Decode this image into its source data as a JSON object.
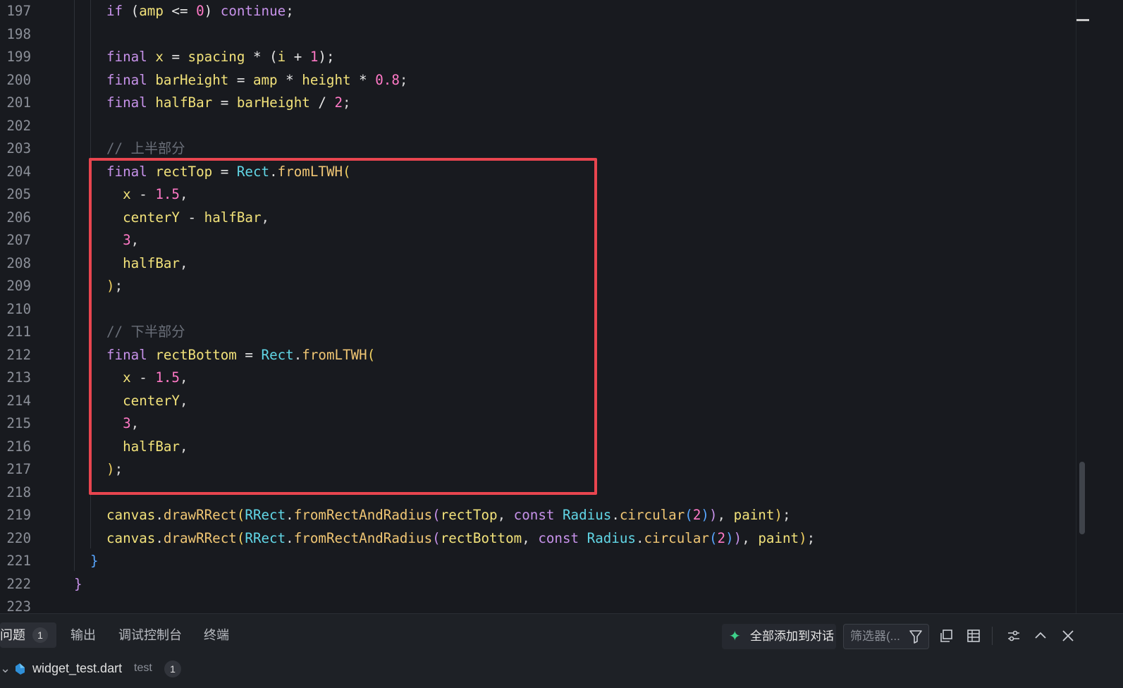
{
  "editor": {
    "lines": [
      {
        "num": "197",
        "tokens": [
          [
            "kw",
            "if"
          ],
          [
            "op",
            " ("
          ],
          [
            "id",
            "amp"
          ],
          [
            "op",
            " <= "
          ],
          [
            "num",
            "0"
          ],
          [
            "op",
            ") "
          ],
          [
            "kw",
            "continue"
          ],
          [
            "pn",
            ";"
          ]
        ]
      },
      {
        "num": "198",
        "tokens": []
      },
      {
        "num": "199",
        "tokens": [
          [
            "kw",
            "final"
          ],
          [
            "op",
            " "
          ],
          [
            "id",
            "x"
          ],
          [
            "op",
            " = "
          ],
          [
            "id",
            "spacing"
          ],
          [
            "op",
            " * ("
          ],
          [
            "id",
            "i"
          ],
          [
            "op",
            " + "
          ],
          [
            "num",
            "1"
          ],
          [
            "op",
            ");"
          ]
        ]
      },
      {
        "num": "200",
        "tokens": [
          [
            "kw",
            "final"
          ],
          [
            "op",
            " "
          ],
          [
            "id",
            "barHeight"
          ],
          [
            "op",
            " = "
          ],
          [
            "id",
            "amp"
          ],
          [
            "op",
            " * "
          ],
          [
            "id",
            "height"
          ],
          [
            "op",
            " * "
          ],
          [
            "num",
            "0.8"
          ],
          [
            "pn",
            ";"
          ]
        ]
      },
      {
        "num": "201",
        "tokens": [
          [
            "kw",
            "final"
          ],
          [
            "op",
            " "
          ],
          [
            "id",
            "halfBar"
          ],
          [
            "op",
            " = "
          ],
          [
            "id",
            "barHeight"
          ],
          [
            "op",
            " / "
          ],
          [
            "num",
            "2"
          ],
          [
            "pn",
            ";"
          ]
        ]
      },
      {
        "num": "202",
        "tokens": []
      },
      {
        "num": "203",
        "tokens": [
          [
            "cm",
            "// 上半部分"
          ]
        ]
      },
      {
        "num": "204",
        "tokens": [
          [
            "kw",
            "final"
          ],
          [
            "op",
            " "
          ],
          [
            "id",
            "rectTop"
          ],
          [
            "op",
            " = "
          ],
          [
            "ty",
            "Rect"
          ],
          [
            "pn",
            "."
          ],
          [
            "fn",
            "fromLTWH"
          ],
          [
            "br1",
            "("
          ]
        ]
      },
      {
        "num": "205",
        "tokens": [
          [
            "op",
            "  "
          ],
          [
            "id",
            "x"
          ],
          [
            "op",
            " - "
          ],
          [
            "num",
            "1.5"
          ],
          [
            "pn",
            ","
          ]
        ]
      },
      {
        "num": "206",
        "tokens": [
          [
            "op",
            "  "
          ],
          [
            "id",
            "centerY"
          ],
          [
            "op",
            " - "
          ],
          [
            "id",
            "halfBar"
          ],
          [
            "pn",
            ","
          ]
        ]
      },
      {
        "num": "207",
        "tokens": [
          [
            "op",
            "  "
          ],
          [
            "num",
            "3"
          ],
          [
            "pn",
            ","
          ]
        ]
      },
      {
        "num": "208",
        "tokens": [
          [
            "op",
            "  "
          ],
          [
            "id",
            "halfBar"
          ],
          [
            "pn",
            ","
          ]
        ]
      },
      {
        "num": "209",
        "tokens": [
          [
            "br1",
            ")"
          ],
          [
            "pn",
            ";"
          ]
        ]
      },
      {
        "num": "210",
        "tokens": []
      },
      {
        "num": "211",
        "tokens": [
          [
            "cm",
            "// 下半部分"
          ]
        ]
      },
      {
        "num": "212",
        "tokens": [
          [
            "kw",
            "final"
          ],
          [
            "op",
            " "
          ],
          [
            "id",
            "rectBottom"
          ],
          [
            "op",
            " = "
          ],
          [
            "ty",
            "Rect"
          ],
          [
            "pn",
            "."
          ],
          [
            "fn",
            "fromLTWH"
          ],
          [
            "br1",
            "("
          ]
        ]
      },
      {
        "num": "213",
        "tokens": [
          [
            "op",
            "  "
          ],
          [
            "id",
            "x"
          ],
          [
            "op",
            " - "
          ],
          [
            "num",
            "1.5"
          ],
          [
            "pn",
            ","
          ]
        ]
      },
      {
        "num": "214",
        "tokens": [
          [
            "op",
            "  "
          ],
          [
            "id",
            "centerY"
          ],
          [
            "pn",
            ","
          ]
        ]
      },
      {
        "num": "215",
        "tokens": [
          [
            "op",
            "  "
          ],
          [
            "num",
            "3"
          ],
          [
            "pn",
            ","
          ]
        ]
      },
      {
        "num": "216",
        "tokens": [
          [
            "op",
            "  "
          ],
          [
            "id",
            "halfBar"
          ],
          [
            "pn",
            ","
          ]
        ]
      },
      {
        "num": "217",
        "tokens": [
          [
            "br1",
            ")"
          ],
          [
            "pn",
            ";"
          ]
        ]
      },
      {
        "num": "218",
        "tokens": []
      },
      {
        "num": "219",
        "tokens": [
          [
            "id",
            "canvas"
          ],
          [
            "pn",
            "."
          ],
          [
            "fn",
            "drawRRect"
          ],
          [
            "br1",
            "("
          ],
          [
            "ty",
            "RRect"
          ],
          [
            "pn",
            "."
          ],
          [
            "fn",
            "fromRectAndRadius"
          ],
          [
            "br2",
            "("
          ],
          [
            "id",
            "rectTop"
          ],
          [
            "pn",
            ", "
          ],
          [
            "kw",
            "const"
          ],
          [
            "op",
            " "
          ],
          [
            "ty",
            "Radius"
          ],
          [
            "pn",
            "."
          ],
          [
            "fn",
            "circular"
          ],
          [
            "br3",
            "("
          ],
          [
            "num",
            "2"
          ],
          [
            "br3",
            ")"
          ],
          [
            "br2",
            ")"
          ],
          [
            "pn",
            ", "
          ],
          [
            "id",
            "paint"
          ],
          [
            "br1",
            ")"
          ],
          [
            "pn",
            ";"
          ]
        ]
      },
      {
        "num": "220",
        "tokens": [
          [
            "id",
            "canvas"
          ],
          [
            "pn",
            "."
          ],
          [
            "fn",
            "drawRRect"
          ],
          [
            "br1",
            "("
          ],
          [
            "ty",
            "RRect"
          ],
          [
            "pn",
            "."
          ],
          [
            "fn",
            "fromRectAndRadius"
          ],
          [
            "br2",
            "("
          ],
          [
            "id",
            "rectBottom"
          ],
          [
            "pn",
            ", "
          ],
          [
            "kw",
            "const"
          ],
          [
            "op",
            " "
          ],
          [
            "ty",
            "Radius"
          ],
          [
            "pn",
            "."
          ],
          [
            "fn",
            "circular"
          ],
          [
            "br3",
            "("
          ],
          [
            "num",
            "2"
          ],
          [
            "br3",
            ")"
          ],
          [
            "br2",
            ")"
          ],
          [
            "pn",
            ", "
          ],
          [
            "id",
            "paint"
          ],
          [
            "br1",
            ")"
          ],
          [
            "pn",
            ";"
          ]
        ]
      },
      {
        "num": "221",
        "tokens": [
          [
            "br3",
            "}"
          ]
        ]
      },
      {
        "num": "222",
        "tokens": [
          [
            "br2",
            "}"
          ]
        ]
      },
      {
        "num": "223",
        "tokens": []
      }
    ]
  },
  "panel": {
    "tabs": {
      "problems": "问题",
      "problems_count": "1",
      "output": "输出",
      "debug_console": "调试控制台",
      "terminal": "终端"
    },
    "add_all_label": "全部添加到对话",
    "filter_placeholder": "筛选器(...",
    "problem": {
      "file": "widget_test.dart",
      "folder": "test",
      "count": "1"
    }
  },
  "colors": {
    "highlight_border": "#e8454f",
    "keyword": "#c792ea",
    "function": "#f0c674",
    "type": "#61d6e6",
    "number": "#ff79c6",
    "identifier": "#f2e27a"
  }
}
